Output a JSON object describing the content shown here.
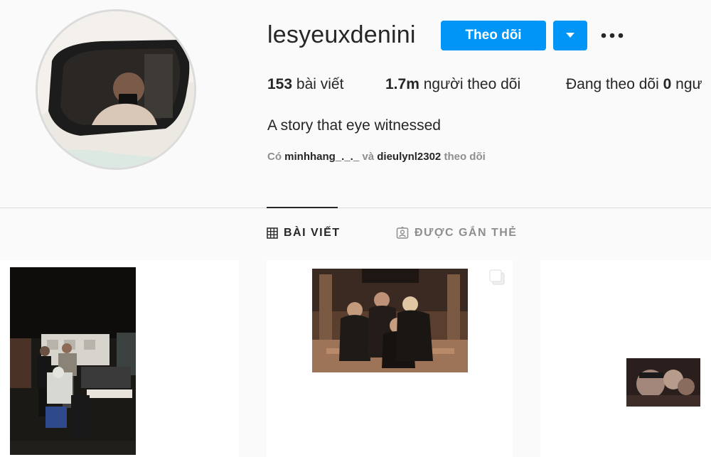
{
  "profile": {
    "username": "lesyeuxdenini",
    "follow_label": "Theo dõi",
    "bio": "A story that eye witnessed"
  },
  "stats": {
    "posts_count": "153",
    "posts_label": "bài viết",
    "followers_count": "1.7m",
    "followers_label": "người theo dõi",
    "following_label": "Đang theo dõi",
    "following_count": "0",
    "following_suffix": "ngư"
  },
  "followed_by": {
    "prefix": "Có",
    "user1": "minhhang_._._",
    "conj": "và",
    "user2": "dieulynl2302",
    "suffix": "theo dõi"
  },
  "tabs": {
    "posts": "BÀI VIẾT",
    "tagged": "ĐƯỢC GẮN THẺ"
  },
  "icons": {
    "dropdown": "caret-down-icon",
    "more": "more-options-icon",
    "grid": "grid-icon",
    "tagged": "tagged-user-icon",
    "multi": "multiple-photos-icon"
  },
  "colors": {
    "accent": "#0095f6",
    "text": "#262626",
    "muted": "#8e8e8e",
    "border": "#dbdbdb",
    "background": "#fafafa"
  }
}
